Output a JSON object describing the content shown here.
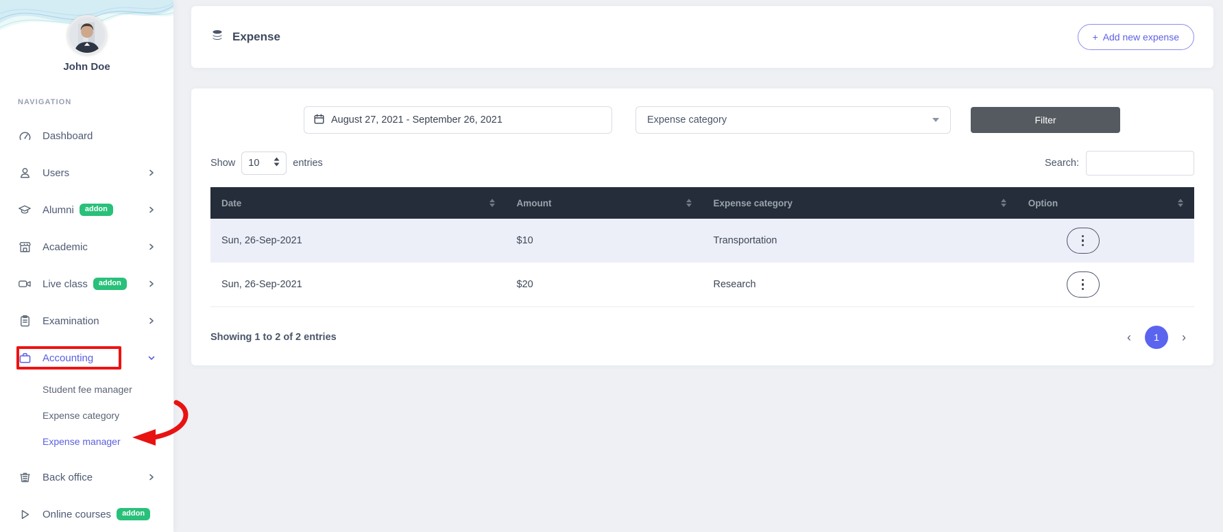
{
  "colors": {
    "accent_purple": "#5a5fe0",
    "badge_green": "#29c07a",
    "table_header_bg": "#242d39",
    "row_alt_bg": "#edeff8",
    "filter_button_bg": "#555a60",
    "pagination_active_bg": "#5a64ee",
    "annotation_red": "#ee1212"
  },
  "icons": {
    "plus": "+",
    "kebab": "vertical-ellipsis",
    "chevron_left": "‹",
    "chevron_right": "›"
  },
  "sidebar": {
    "user_name": "John Doe",
    "section_label": "NAVIGATION",
    "addon_badge": "addon",
    "items": {
      "dashboard": "Dashboard",
      "users": "Users",
      "alumni": "Alumni",
      "academic": "Academic",
      "live_class": "Live class",
      "examination": "Examination",
      "accounting": "Accounting",
      "back_office": "Back office",
      "online_courses": "Online courses"
    },
    "accounting_submenu": {
      "student_fee_manager": "Student fee manager",
      "expense_category": "Expense category",
      "expense_manager": "Expense manager"
    }
  },
  "header": {
    "title": "Expense",
    "add_button_label": "Add new expense"
  },
  "filters": {
    "date_range": "August 27, 2021 - September 26, 2021",
    "category_placeholder": "Expense category",
    "filter_button": "Filter"
  },
  "table_controls": {
    "show_label": "Show",
    "page_size": "10",
    "entries_label": "entries",
    "search_label": "Search:",
    "search_value": ""
  },
  "table": {
    "columns": [
      "Date",
      "Amount",
      "Expense category",
      "Option"
    ],
    "rows": [
      {
        "date": "Sun, 26-Sep-2021",
        "amount": "$10",
        "category": "Transportation"
      },
      {
        "date": "Sun, 26-Sep-2021",
        "amount": "$20",
        "category": "Research"
      }
    ]
  },
  "footer": {
    "info": "Showing 1 to 2 of 2 entries",
    "current_page": "1"
  }
}
